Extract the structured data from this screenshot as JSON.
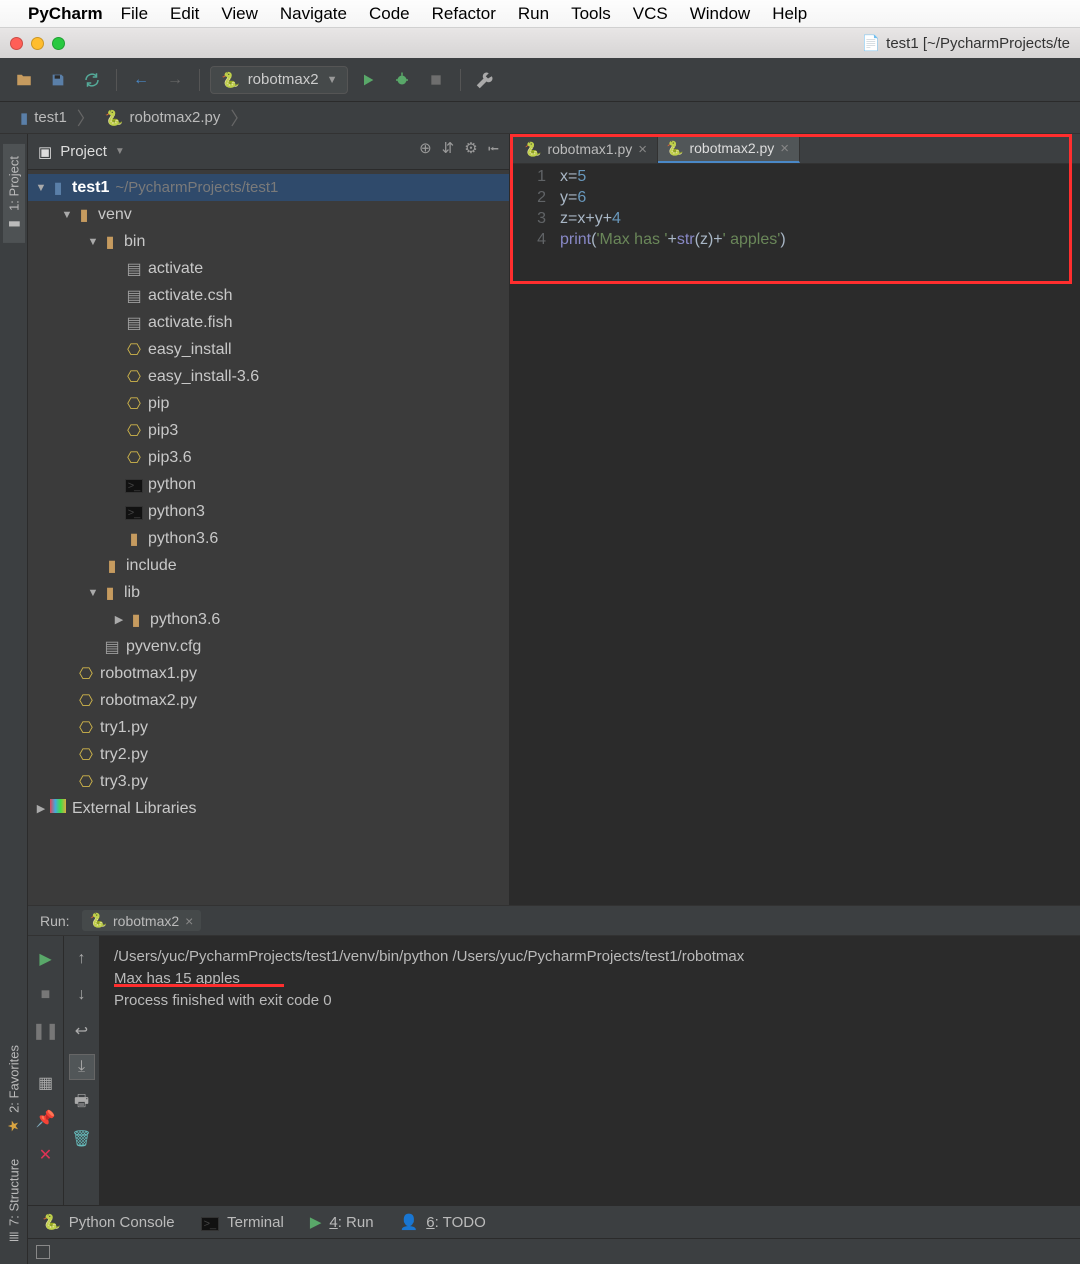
{
  "mac_menu": {
    "app": "PyCharm",
    "items": [
      "File",
      "Edit",
      "View",
      "Navigate",
      "Code",
      "Refactor",
      "Run",
      "Tools",
      "VCS",
      "Window",
      "Help"
    ]
  },
  "window_title": "test1 [~/PycharmProjects/te",
  "run_config_name": "robotmax2",
  "breadcrumb": {
    "root": "test1",
    "file": "robotmax2.py"
  },
  "project_panel": {
    "title": "Project",
    "root": {
      "name": "test1",
      "path": "~/PycharmProjects/test1"
    },
    "tree": {
      "venv": "venv",
      "bin": "bin",
      "bin_items": [
        "activate",
        "activate.csh",
        "activate.fish",
        "easy_install",
        "easy_install-3.6",
        "pip",
        "pip3",
        "pip3.6",
        "python",
        "python3",
        "python3.6"
      ],
      "include": "include",
      "lib": "lib",
      "lib_child": "python3.6",
      "pyvenv": "pyvenv.cfg",
      "root_files": [
        "robotmax1.py",
        "robotmax2.py",
        "try1.py",
        "try2.py",
        "try3.py"
      ],
      "external": "External Libraries"
    }
  },
  "editor": {
    "tabs": [
      "robotmax1.py",
      "robotmax2.py"
    ],
    "active_tab": 1,
    "lines": [
      {
        "n": "1",
        "t1": "x",
        "op": "=",
        "num": "5"
      },
      {
        "n": "2",
        "t1": "y",
        "op": "=",
        "num": "6"
      },
      {
        "n": "3",
        "t1": "z",
        "op": "=",
        "expr": "x+y+",
        "num": "4"
      },
      {
        "n": "4",
        "fn": "print",
        "s1": "'Max has '",
        "plus1": "+",
        "bi": "str",
        "lp2": "(",
        "v": "z",
        "rp2": ")",
        "plus2": "+",
        "s2": "' apples'",
        "rp": ")"
      }
    ]
  },
  "run_panel": {
    "label": "Run:",
    "tabname": "robotmax2",
    "out1": "/Users/yuc/PycharmProjects/test1/venv/bin/python /Users/yuc/PycharmProjects/test1/robotmax",
    "out2": "Max has 15 apples",
    "out3": "",
    "out4": "Process finished with exit code 0"
  },
  "bottom_tabs": {
    "console": "Python Console",
    "terminal": "Terminal",
    "run": "4: Run",
    "run_u": "4",
    "run_t": ": Run",
    "todo": "6: TODO",
    "todo_u": "6",
    "todo_t": ": TODO"
  },
  "side_tabs": {
    "project": "1: Project",
    "structure": "7: Structure",
    "favorites": "2: Favorites"
  }
}
